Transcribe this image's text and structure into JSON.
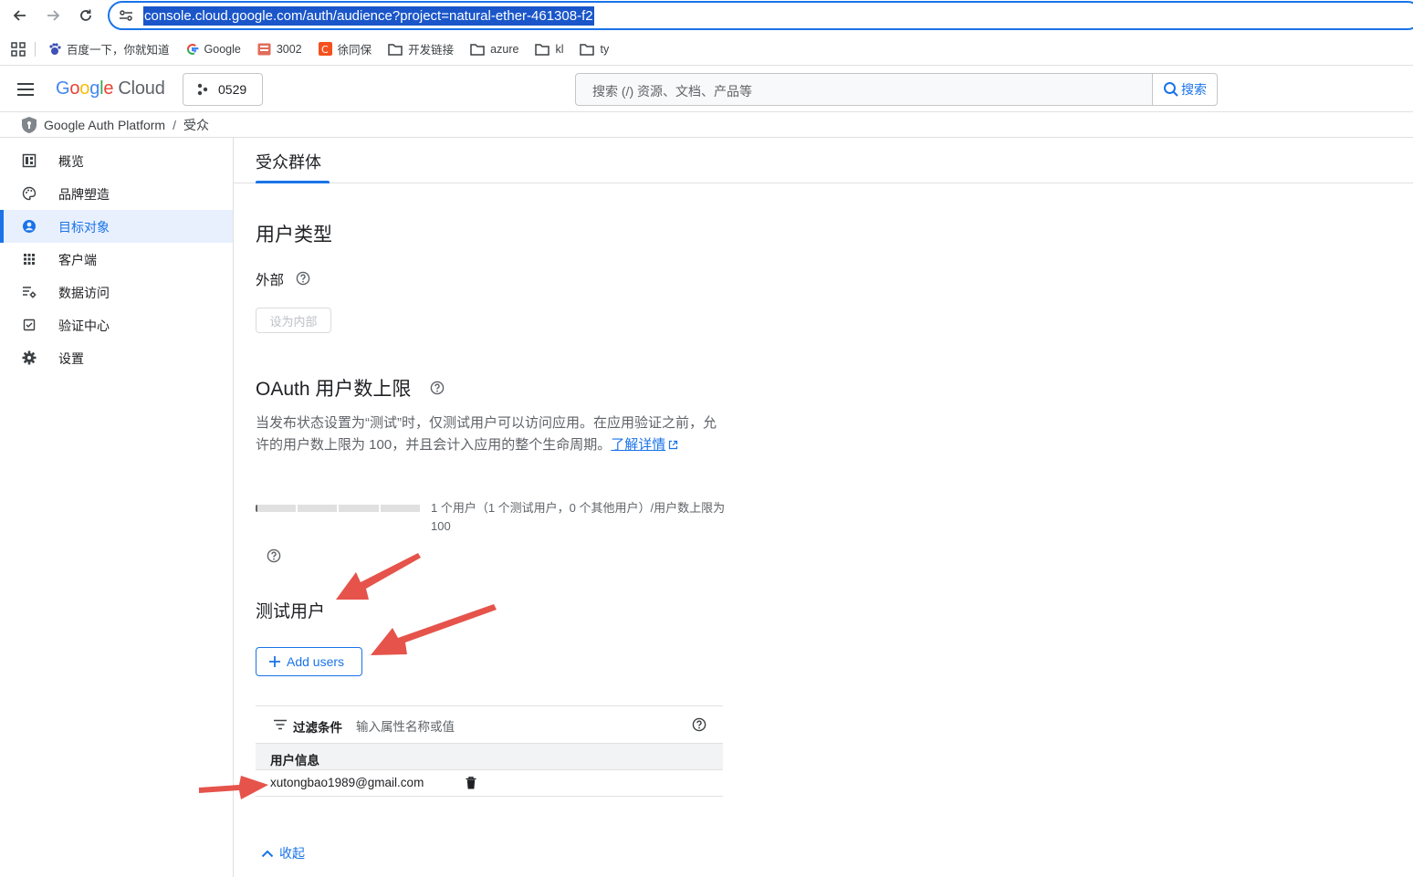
{
  "browser": {
    "url": "console.cloud.google.com/auth/audience?project=natural-ether-461308-f2",
    "bookmarks": [
      {
        "label": "百度一下，你就知道",
        "icon": "baidu-icon"
      },
      {
        "label": "Google",
        "icon": "google-icon"
      },
      {
        "label": "3002",
        "icon": "bookmark-red-icon"
      },
      {
        "label": "徐同保",
        "icon": "csdn-icon"
      },
      {
        "label": "开发链接",
        "icon": "folder-icon"
      },
      {
        "label": "azure",
        "icon": "folder-icon"
      },
      {
        "label": "kl",
        "icon": "folder-icon"
      },
      {
        "label": "ty",
        "icon": "folder-icon"
      }
    ]
  },
  "header": {
    "logo_letters": [
      "G",
      "o",
      "o",
      "g",
      "l",
      "e"
    ],
    "logo_cloud": "Cloud",
    "project": "0529",
    "search_placeholder": "搜索 (/) 资源、文档、产品等",
    "search_button": "搜索"
  },
  "breadcrumb": {
    "root": "Google Auth Platform",
    "sep": "/",
    "current": "受众"
  },
  "sidebar": {
    "items": [
      {
        "label": "概览",
        "icon": "dashboard-icon"
      },
      {
        "label": "品牌塑造",
        "icon": "palette-icon"
      },
      {
        "label": "目标对象",
        "icon": "account-circle-icon"
      },
      {
        "label": "客户端",
        "icon": "apps-grid-icon"
      },
      {
        "label": "数据访问",
        "icon": "data-settings-icon"
      },
      {
        "label": "验证中心",
        "icon": "verified-checkbox-icon"
      },
      {
        "label": "设置",
        "icon": "gear-icon"
      }
    ],
    "active_index": 2
  },
  "main": {
    "tab": "受众群体",
    "user_type_heading": "用户类型",
    "user_type_value": "外部",
    "make_internal_button": "设为内部",
    "oauth_heading": "OAuth 用户数上限",
    "oauth_desc": "当发布状态设置为“测试”时，仅测试用户可以访问应用。在应用验证之前，允许的用户数上限为 100，并且会计入应用的整个生命周期。",
    "learn_more": "了解详情",
    "progress_fraction": 0.01,
    "progress_text": "1 个用户（1 个测试用户，0 个其他用户）/用户数上限为 100",
    "test_users_heading": "测试用户",
    "add_users_button": "Add users",
    "filter_label": "过滤条件",
    "filter_placeholder": "输入属性名称或值",
    "table_header": "用户信息",
    "rows": [
      {
        "email": "xutongbao1989@gmail.com"
      }
    ],
    "collapse": "收起"
  },
  "colors": {
    "accent": "#1a73e8",
    "arrow": "#e5534b"
  }
}
